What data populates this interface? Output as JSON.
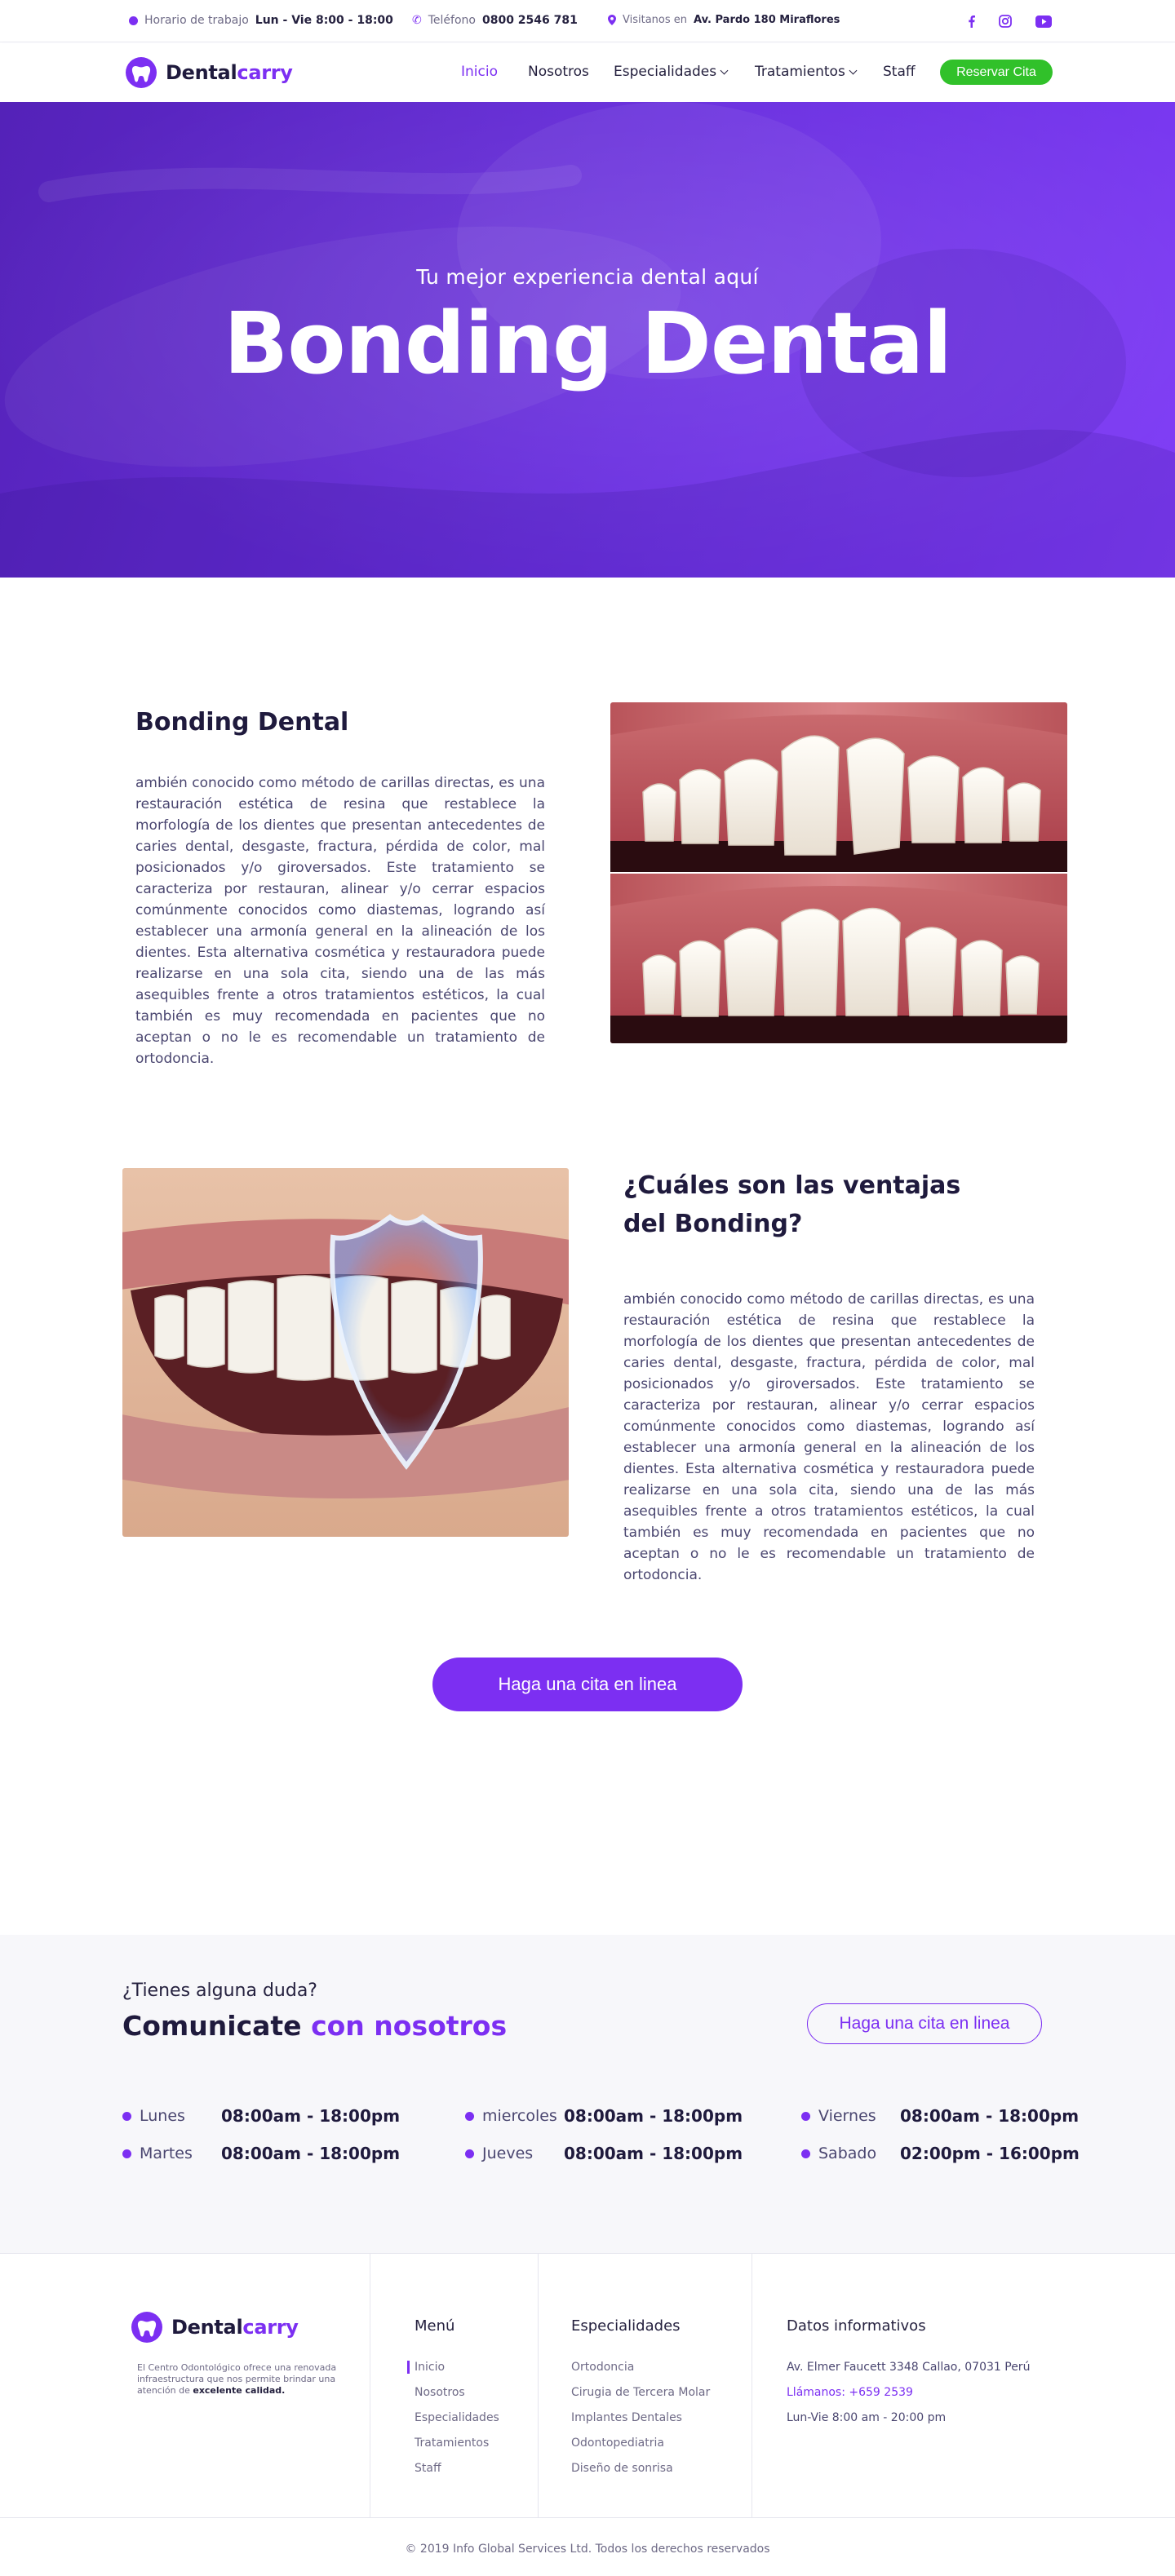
{
  "topbar": {
    "hours_label": "Horario de trabajo",
    "hours_value": "Lun - Vie 8:00 - 18:00",
    "phone_label": "Teléfono",
    "phone_value": "0800 2546 781",
    "visit_label": "Visitanos en",
    "visit_value": "Av. Pardo 180 Miraflores",
    "social_icons": [
      "facebook-icon",
      "instagram-icon",
      "youtube-icon"
    ]
  },
  "brand": {
    "name_part1": "Dental",
    "name_part2": "carry",
    "accent_color": "#7c2ff2",
    "green_color": "#31c12a"
  },
  "nav": {
    "items": [
      {
        "label": "Inicio",
        "active": true
      },
      {
        "label": "Nosotros"
      },
      {
        "label": "Especialidades",
        "dropdown": true
      },
      {
        "label": "Tratamientos",
        "dropdown": true
      },
      {
        "label": "Staff"
      }
    ],
    "cta_label": "Reservar Cita"
  },
  "hero": {
    "subtitle": "Tu mejor experiencia dental aquí",
    "title": "Bonding Dental"
  },
  "section1": {
    "title": "Bonding Dental",
    "body": "ambién conocido como método de carillas directas, es una restauración estética de resina que restablece la morfología de los dientes que presentan antecedentes de caries dental, desgaste, fractura, pérdida de color, mal posicionados y/o giroversados. Este tratamiento se caracteriza por restauran, alinear y/o cerrar espacios comúnmente conocidos como diastemas, logrando así establecer una armonía general en la alineación de los dientes. Esta alternativa cosmética y restauradora puede realizarse en una sola cita, siendo una de las más asequibles frente a otros tratamientos estéticos, la cual también es muy recomendada en pacientes que no aceptan o no le es recomendable un tratamiento de ortodoncia."
  },
  "section2": {
    "title_line1": "¿Cuáles son las ventajas",
    "title_line2": "del Bonding?",
    "body": "ambién conocido como método de carillas directas, es una restauración estética de resina que restablece la morfología de los dientes que presentan antecedentes de caries dental, desgaste, fractura, pérdida de color, mal posicionados y/o giroversados. Este tratamiento se caracteriza por restauran, alinear y/o cerrar espacios comúnmente conocidos como diastemas, logrando así establecer una armonía general en la alineación de los dientes. Esta alternativa cosmética y restauradora puede realizarse en una sola cita, siendo una de las más asequibles frente a otros tratamientos estéticos, la cual también es muy recomendada en pacientes que no aceptan o no le es recomendable un tratamiento de ortodoncia."
  },
  "cta": {
    "label": "Haga una cita en linea"
  },
  "contact": {
    "question": "¿Tienes alguna duda?",
    "title_part1": "Comunicate",
    "title_part2": "con nosotros",
    "button_label": "Haga una cita en linea",
    "schedule": [
      {
        "day": "Lunes",
        "hours": "08:00am - 18:00pm"
      },
      {
        "day": "miercoles",
        "hours": "08:00am - 18:00pm"
      },
      {
        "day": "Viernes",
        "hours": "08:00am - 18:00pm"
      },
      {
        "day": "Martes",
        "hours": "08:00am - 18:00pm"
      },
      {
        "day": "Jueves",
        "hours": "08:00am - 18:00pm"
      },
      {
        "day": "Sabado",
        "hours": "02:00pm - 16:00pm"
      }
    ]
  },
  "footer": {
    "description": "El Centro Odontológico ofrece una renovada infraestructura que nos permite brindar una atención de",
    "description_bold": "excelente calidad.",
    "menu_title": "Menú",
    "menu_items": [
      "Inicio",
      "Nosotros",
      "Especialidades",
      "Tratamientos",
      "Staff"
    ],
    "specialties_title": "Especialidades",
    "specialties_items": [
      "Ortodoncia",
      "Cirugia de Tercera Molar",
      "Implantes Dentales",
      "Odontopediatria",
      "Diseño de sonrisa"
    ],
    "info_title": "Datos informativos",
    "address": "Av. Elmer Faucett 3348 Callao, 07031 Perú",
    "phone": "Llámanos: +659 2539",
    "hours": "Lun-Vie 8:00 am - 20:00 pm",
    "copyright": "© 2019 Info Global Services Ltd. Todos los derechos reservados"
  }
}
